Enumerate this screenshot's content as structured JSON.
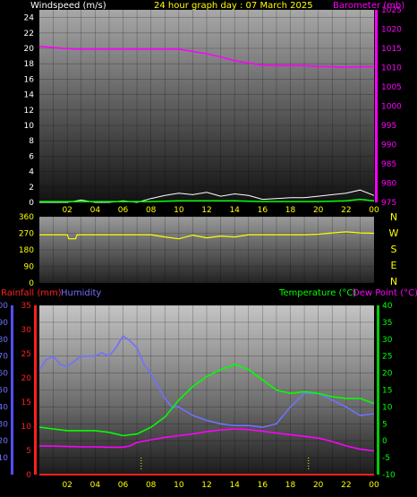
{
  "header": {
    "windspeed_label": "Windspeed (m/s)",
    "graph_title": "24 hour graph day : 07 March 2025",
    "barometer_label": "Barometer (mb)"
  },
  "direction_labels": [
    "N",
    "W",
    "S",
    "E",
    "N"
  ],
  "bottom_header": {
    "rainfall_label": "Rainfall (mm)",
    "humidity_label": "Humidity",
    "temperature_label": "Temperature (°C)",
    "dewpoint_label": "Dew Point (°C)"
  },
  "colors": {
    "windspeed_axis": "#ffffff",
    "barometer": "#ff00ff",
    "direction": "#ffff00",
    "rainfall": "#ff2020",
    "humidity": "#7070ff",
    "temperature": "#00ff00",
    "dewpoint": "#ff00ff",
    "title": "#ffff00"
  },
  "chart_data": [
    {
      "type": "line",
      "id": "wind_baro",
      "x_ticks": [
        "02",
        "04",
        "06",
        "08",
        "10",
        "12",
        "14",
        "16",
        "18",
        "20",
        "22",
        "00"
      ],
      "y_left": {
        "label": "Windspeed (m/s)",
        "ticks": [
          0,
          2,
          4,
          6,
          8,
          10,
          12,
          14,
          16,
          18,
          20,
          22,
          24
        ],
        "ylim": [
          0,
          25
        ]
      },
      "y_right": {
        "label": "Barometer (mb)",
        "ticks": [
          975,
          980,
          985,
          990,
          995,
          1000,
          1005,
          1010,
          1015,
          1020,
          1025
        ],
        "ylim": [
          975,
          1025
        ]
      },
      "series": [
        {
          "name": "Barometer (mb)",
          "axis": "right",
          "x": [
            0.0,
            1,
            2,
            3,
            4,
            5,
            6,
            7,
            8,
            9,
            10,
            11,
            12,
            13,
            14,
            15,
            16,
            17,
            18,
            19,
            20,
            21,
            22,
            23,
            24
          ],
          "y": [
            1015.5,
            1015.2,
            1014.9,
            1014.8,
            1014.8,
            1014.8,
            1014.8,
            1014.8,
            1014.8,
            1014.8,
            1014.8,
            1014.2,
            1013.6,
            1012.8,
            1011.8,
            1011.2,
            1010.6,
            1010.5,
            1010.5,
            1010.5,
            1010.3,
            1010.2,
            1010.1,
            1010.2,
            1010.2
          ]
        },
        {
          "name": "Wind Gust",
          "axis": "left",
          "x": [
            0,
            2,
            3,
            4,
            5,
            6,
            7,
            8,
            9,
            10,
            11,
            12,
            13,
            14,
            15,
            16,
            17,
            18,
            19,
            20,
            21,
            22,
            23,
            24
          ],
          "y": [
            0,
            0,
            0.3,
            0,
            0,
            0.2,
            0,
            0.5,
            0.9,
            1.2,
            1.0,
            1.3,
            0.8,
            1.1,
            0.9,
            0.4,
            0.5,
            0.6,
            0.6,
            0.8,
            1.0,
            1.2,
            1.6,
            0.9
          ]
        },
        {
          "name": "Wind Speed",
          "axis": "left",
          "x": [
            0,
            4,
            8,
            10,
            12,
            14,
            16,
            18,
            20,
            22,
            23,
            24
          ],
          "y": [
            0.1,
            0.1,
            0.1,
            0.2,
            0.2,
            0.2,
            0.1,
            0.1,
            0.1,
            0.2,
            0.4,
            0.2
          ]
        }
      ]
    },
    {
      "type": "line",
      "id": "direction",
      "y_ticks": [
        0,
        90,
        180,
        270,
        360
      ],
      "ylim": [
        0,
        360
      ],
      "series": [
        {
          "name": "Wind Direction",
          "x": [
            0,
            1,
            2,
            2.1,
            2.6,
            2.7,
            3,
            4,
            5,
            6,
            7,
            8,
            9,
            10,
            11,
            12,
            13,
            14,
            15,
            16,
            17,
            18,
            19,
            20,
            21,
            22,
            23,
            24
          ],
          "y": [
            262,
            262,
            262,
            240,
            240,
            262,
            262,
            262,
            262,
            262,
            262,
            262,
            250,
            240,
            260,
            245,
            255,
            250,
            262,
            262,
            262,
            262,
            262,
            265,
            272,
            278,
            272,
            270
          ]
        }
      ]
    },
    {
      "type": "line",
      "id": "temp_hum",
      "x_ticks": [
        "02",
        "04",
        "06",
        "08",
        "10",
        "12",
        "14",
        "16",
        "18",
        "20",
        "22",
        "00"
      ],
      "y_left_rain": {
        "label": "Rainfall (mm)",
        "ticks": [
          0,
          5,
          10,
          15,
          20,
          25,
          30,
          35
        ],
        "ylim": [
          0,
          35
        ]
      },
      "y_left_hum": {
        "label": "Humidity",
        "ticks": [
          10,
          20,
          30,
          40,
          50,
          60,
          70,
          80,
          90,
          100
        ],
        "ylim": [
          0,
          100
        ]
      },
      "y_right_temp": {
        "label": "Temperature (°C)",
        "ticks": [
          -10,
          -5,
          0,
          5,
          10,
          15,
          20,
          25,
          30,
          35,
          40
        ],
        "ylim": [
          -10,
          40
        ]
      },
      "series": [
        {
          "name": "Humidity",
          "axis": "humidity",
          "x": [
            0,
            0.5,
            1,
            1.5,
            2,
            3,
            4,
            4.5,
            5,
            5.5,
            6,
            6.5,
            7,
            7.5,
            8,
            8.5,
            9,
            9.5,
            10,
            11,
            12,
            13,
            14,
            15,
            16,
            17,
            18,
            19,
            20,
            21,
            22,
            23,
            24
          ],
          "y": [
            62,
            68,
            70,
            65,
            64,
            70,
            70,
            72,
            70,
            75,
            82,
            79,
            75,
            65,
            60,
            52,
            45,
            40,
            40,
            35,
            32,
            30,
            29,
            29,
            28,
            30,
            40,
            48,
            48,
            44,
            40,
            35,
            36
          ]
        },
        {
          "name": "Temperature (°C)",
          "axis": "temp",
          "x": [
            0,
            1,
            2,
            3,
            4,
            5,
            6,
            7,
            8,
            9,
            10,
            11,
            12,
            13,
            14,
            15,
            16,
            17,
            18,
            19,
            20,
            21,
            22,
            23,
            24
          ],
          "y": [
            4,
            3.5,
            3,
            3,
            3,
            2.5,
            1.5,
            2,
            4,
            7,
            12,
            16,
            19,
            21,
            22.5,
            21,
            18,
            15,
            14,
            14.5,
            14,
            13,
            12.5,
            12.5,
            11
          ]
        },
        {
          "name": "Dew Point (°C)",
          "axis": "temp",
          "x": [
            0,
            1,
            2,
            3,
            4,
            5,
            6,
            6.5,
            7,
            8,
            9,
            10,
            11,
            12,
            13,
            14,
            15,
            16,
            17,
            18,
            19,
            20,
            21,
            22,
            23,
            24
          ],
          "y": [
            -1.5,
            -1.6,
            -1.7,
            -1.8,
            -1.8,
            -1.9,
            -1.9,
            -1.5,
            -0.5,
            0.3,
            1.0,
            1.5,
            2.0,
            2.7,
            3.2,
            3.5,
            3.3,
            2.8,
            2.3,
            1.8,
            1.3,
            0.8,
            -0.2,
            -1.5,
            -2.5,
            -3.0
          ]
        },
        {
          "name": "Rainfall (mm)",
          "axis": "rain",
          "x": [
            0,
            24
          ],
          "y": [
            0,
            0
          ]
        }
      ]
    }
  ]
}
